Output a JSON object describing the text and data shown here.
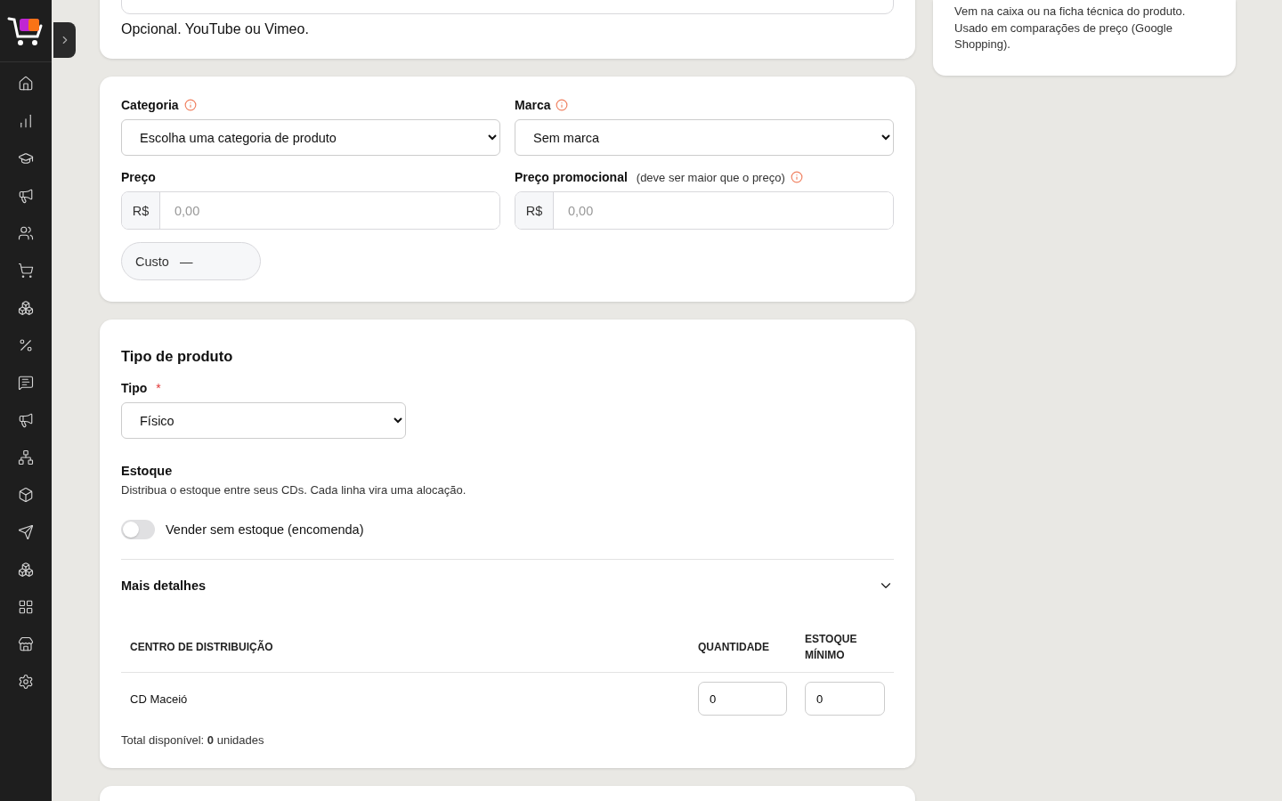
{
  "video_card": {
    "help": "Opcional. YouTube ou Vimeo."
  },
  "side_note": "Vem na caixa ou na ficha técnica do produto. Usado em comparações de preço (Google Shopping).",
  "pricing": {
    "category": {
      "label": "Categoria",
      "value": "Escolha uma categoria de produto"
    },
    "brand": {
      "label": "Marca",
      "value": "Sem marca"
    },
    "price": {
      "label": "Preço",
      "prefix": "R$",
      "placeholder": "0,00"
    },
    "promo_price": {
      "label": "Preço promocional",
      "hint": "(deve ser maior que o preço)",
      "prefix": "R$",
      "placeholder": "0,00"
    },
    "cost": {
      "label": "Custo",
      "value": "—"
    }
  },
  "product_type": {
    "title": "Tipo de produto",
    "type_label": "Tipo",
    "required_mark": "*",
    "type_value": "Físico",
    "stock_title": "Estoque",
    "stock_desc": "Distribua o estoque entre seus CDs. Cada linha vira uma alocação.",
    "backorder": {
      "label": "Vender sem estoque (encomenda)",
      "on": false
    },
    "details": {
      "label": "Mais detalhes",
      "expanded": true
    },
    "table": {
      "columns": [
        "CENTRO DE DISTRIBUIÇÃO",
        "QUANTIDADE",
        "ESTOQUE MÍNIMO"
      ],
      "rows": [
        {
          "name": "CD Maceió",
          "quantity": "0",
          "minimum": "0"
        }
      ]
    },
    "total": "Total disponível: **0** unidades"
  }
}
